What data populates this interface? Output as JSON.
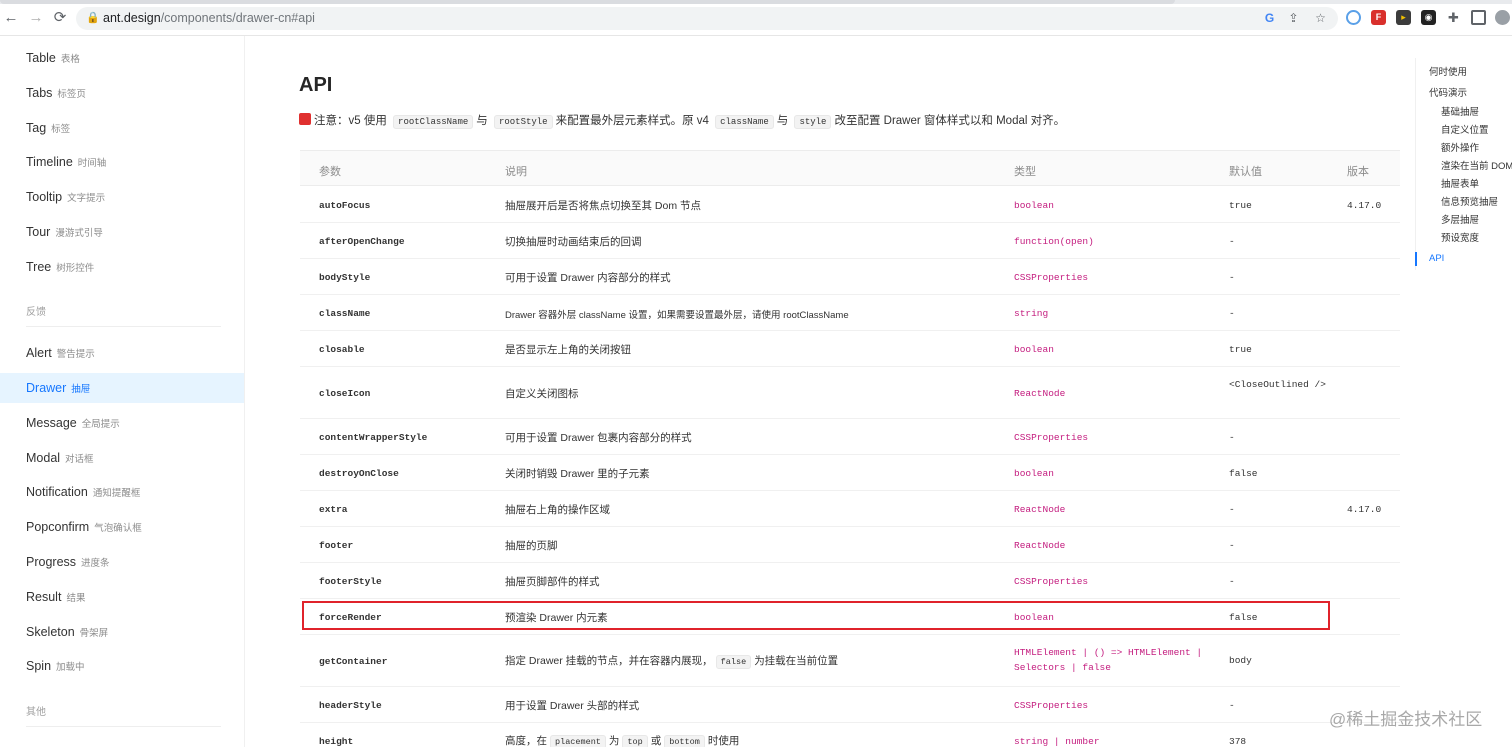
{
  "browser": {
    "url_host": "ant.design",
    "url_path": "/components/drawer-cn#api",
    "nav": {
      "back": "←",
      "forward": "→",
      "reload": "⟳"
    }
  },
  "sidebar": {
    "items_top": [
      {
        "label": "Table",
        "sub": "表格"
      },
      {
        "label": "Tabs",
        "sub": "标签页"
      },
      {
        "label": "Tag",
        "sub": "标签"
      },
      {
        "label": "Timeline",
        "sub": "时间轴"
      },
      {
        "label": "Tooltip",
        "sub": "文字提示"
      },
      {
        "label": "Tour",
        "sub": "漫游式引导"
      },
      {
        "label": "Tree",
        "sub": "树形控件"
      }
    ],
    "group_feedback": "反馈",
    "items_feedback": [
      {
        "label": "Alert",
        "sub": "警告提示"
      },
      {
        "label": "Drawer",
        "sub": "抽屉"
      },
      {
        "label": "Message",
        "sub": "全局提示"
      },
      {
        "label": "Modal",
        "sub": "对话框"
      },
      {
        "label": "Notification",
        "sub": "通知提醒框"
      },
      {
        "label": "Popconfirm",
        "sub": "气泡确认框"
      },
      {
        "label": "Progress",
        "sub": "进度条"
      },
      {
        "label": "Result",
        "sub": "结果"
      },
      {
        "label": "Skeleton",
        "sub": "骨架屏"
      },
      {
        "label": "Spin",
        "sub": "加载中"
      }
    ],
    "group_other": "其他",
    "active": "Drawer"
  },
  "main": {
    "title": "API",
    "notice": {
      "prefix": "注意：v5 使用",
      "code1": "rootClassName",
      "mid1": "与",
      "code2": "rootStyle",
      "mid2": "来配置最外层元素样式。原 v4",
      "code3": "className",
      "mid3": "与",
      "code4": "style",
      "suffix": "改至配置 Drawer 窗体样式以和 Modal 对齐。"
    },
    "table": {
      "headers": {
        "param": "参数",
        "desc": "说明",
        "type": "类型",
        "default": "默认值",
        "version": "版本"
      },
      "rows": [
        {
          "prop": "autoFocus",
          "desc": "抽屉展开后是否将焦点切换至其 Dom 节点",
          "type": "boolean",
          "default": "true",
          "version": "4.17.0"
        },
        {
          "prop": "afterOpenChange",
          "desc": "切换抽屉时动画结束后的回调",
          "type": "function(open)",
          "default": "-",
          "version": ""
        },
        {
          "prop": "bodyStyle",
          "desc": "可用于设置 Drawer 内容部分的样式",
          "type": "CSSProperties",
          "default": "-",
          "version": ""
        },
        {
          "prop": "className",
          "desc": "Drawer 容器外层 className 设置，如果需要设置最外层，请使用 rootClassName",
          "type": "string",
          "default": "-",
          "version": ""
        },
        {
          "prop": "closable",
          "desc": "是否显示左上角的关闭按钮",
          "type": "boolean",
          "default": "true",
          "version": ""
        },
        {
          "prop": "closeIcon",
          "desc": "自定义关闭图标",
          "type": "ReactNode",
          "default": "<CloseOutlined />",
          "version": ""
        },
        {
          "prop": "contentWrapperStyle",
          "desc": "可用于设置 Drawer 包裹内容部分的样式",
          "type": "CSSProperties",
          "default": "-",
          "version": ""
        },
        {
          "prop": "destroyOnClose",
          "desc": "关闭时销毁 Drawer 里的子元素",
          "type": "boolean",
          "default": "false",
          "version": ""
        },
        {
          "prop": "extra",
          "desc": "抽屉右上角的操作区域",
          "type": "ReactNode",
          "default": "-",
          "version": "4.17.0"
        },
        {
          "prop": "footer",
          "desc": "抽屉的页脚",
          "type": "ReactNode",
          "default": "-",
          "version": ""
        },
        {
          "prop": "footerStyle",
          "desc": "抽屉页脚部件的样式",
          "type": "CSSProperties",
          "default": "-",
          "version": ""
        },
        {
          "prop": "forceRender",
          "desc": "预渲染 Drawer 内元素",
          "type": "boolean",
          "default": "false",
          "version": ""
        },
        {
          "prop": "getContainer",
          "desc_pre": "指定 Drawer 挂载的节点，并在容器内展现，",
          "desc_code": "false",
          "desc_post": "为挂载在当前位置",
          "type": "HTMLElement | () => HTMLElement | Selectors | false",
          "default": "body",
          "version": ""
        },
        {
          "prop": "headerStyle",
          "desc": "用于设置 Drawer 头部的样式",
          "type": "CSSProperties",
          "default": "-",
          "version": ""
        },
        {
          "prop": "height",
          "desc_pre": "高度，在",
          "desc_code1": "placement",
          "desc_mid1": "为",
          "desc_code2": "top",
          "desc_mid2": "或",
          "desc_code3": "bottom",
          "desc_post": "时使用",
          "type": "string | number",
          "default": "378",
          "version": ""
        }
      ]
    }
  },
  "anchor": {
    "items": [
      {
        "label": "何时使用",
        "level": 1
      },
      {
        "label": "代码演示",
        "level": 1
      },
      {
        "label": "基础抽屉",
        "level": 2
      },
      {
        "label": "自定义位置",
        "level": 2
      },
      {
        "label": "额外操作",
        "level": 2
      },
      {
        "label": "渲染在当前 DOM",
        "level": 2
      },
      {
        "label": "抽屉表单",
        "level": 2
      },
      {
        "label": "信息预览抽屉",
        "level": 2
      },
      {
        "label": "多层抽屉",
        "level": 2
      },
      {
        "label": "预设宽度",
        "level": 2
      },
      {
        "label": "API",
        "level": 1
      }
    ],
    "active": "API"
  },
  "watermark": "@稀土掘金技术社区",
  "colors": {
    "accent": "#1677ff",
    "type_color": "#c41d7f",
    "highlight": "#e0232b"
  }
}
